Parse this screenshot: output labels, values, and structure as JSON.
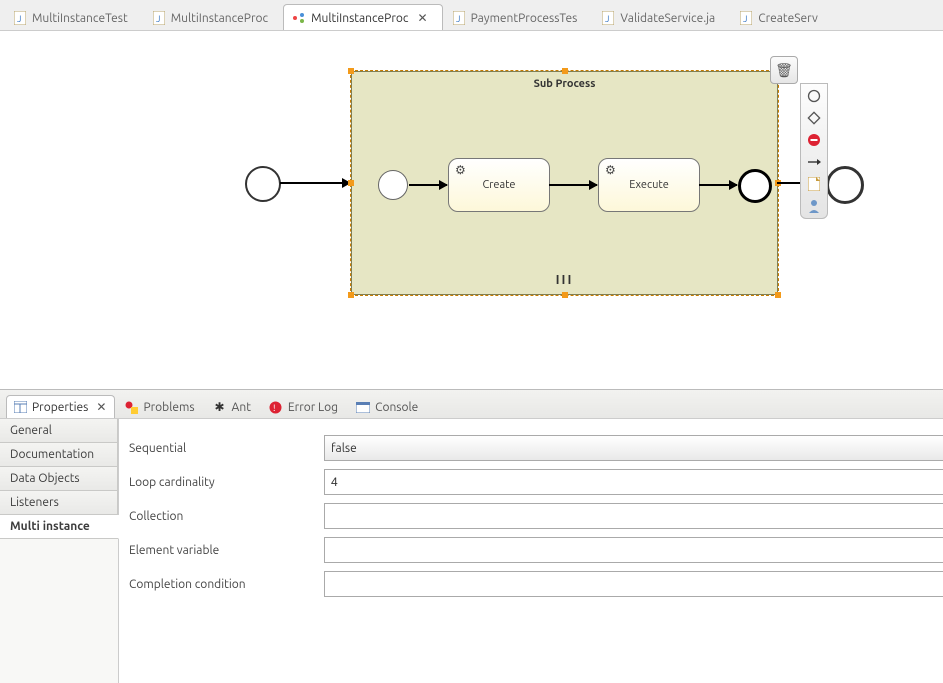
{
  "editorTabs": [
    {
      "label": "MultiInstanceTest",
      "icon": "java"
    },
    {
      "label": "MultiInstanceProc",
      "icon": "java"
    },
    {
      "label": "MultiInstanceProc",
      "icon": "bpmn",
      "active": true
    },
    {
      "label": "PaymentProcessTes",
      "icon": "java"
    },
    {
      "label": "ValidateService.ja",
      "icon": "java"
    },
    {
      "label": "CreateServ",
      "icon": "java"
    }
  ],
  "diagram": {
    "subprocess_title": "Sub Process",
    "task_create": "Create",
    "task_execute": "Execute",
    "mi_marker": "III"
  },
  "palette": {
    "trash": "trash",
    "items": [
      "circle-icon",
      "diamond-icon",
      "minus-circle-icon",
      "arrow-icon",
      "note-icon",
      "person-icon"
    ]
  },
  "lowerTabs": [
    {
      "label": "Properties",
      "active": true
    },
    {
      "label": "Problems"
    },
    {
      "label": "Ant"
    },
    {
      "label": "Error Log"
    },
    {
      "label": "Console"
    }
  ],
  "sideTabs": [
    {
      "label": "General"
    },
    {
      "label": "Documentation"
    },
    {
      "label": "Data Objects"
    },
    {
      "label": "Listeners"
    },
    {
      "label": "Multi instance",
      "active": true
    }
  ],
  "form": {
    "sequential_label": "Sequential",
    "sequential_value": "false",
    "loop_label": "Loop cardinality",
    "loop_value": "4",
    "collection_label": "Collection",
    "collection_value": "",
    "elemvar_label": "Element variable",
    "elemvar_value": "",
    "completion_label": "Completion condition",
    "completion_value": ""
  }
}
